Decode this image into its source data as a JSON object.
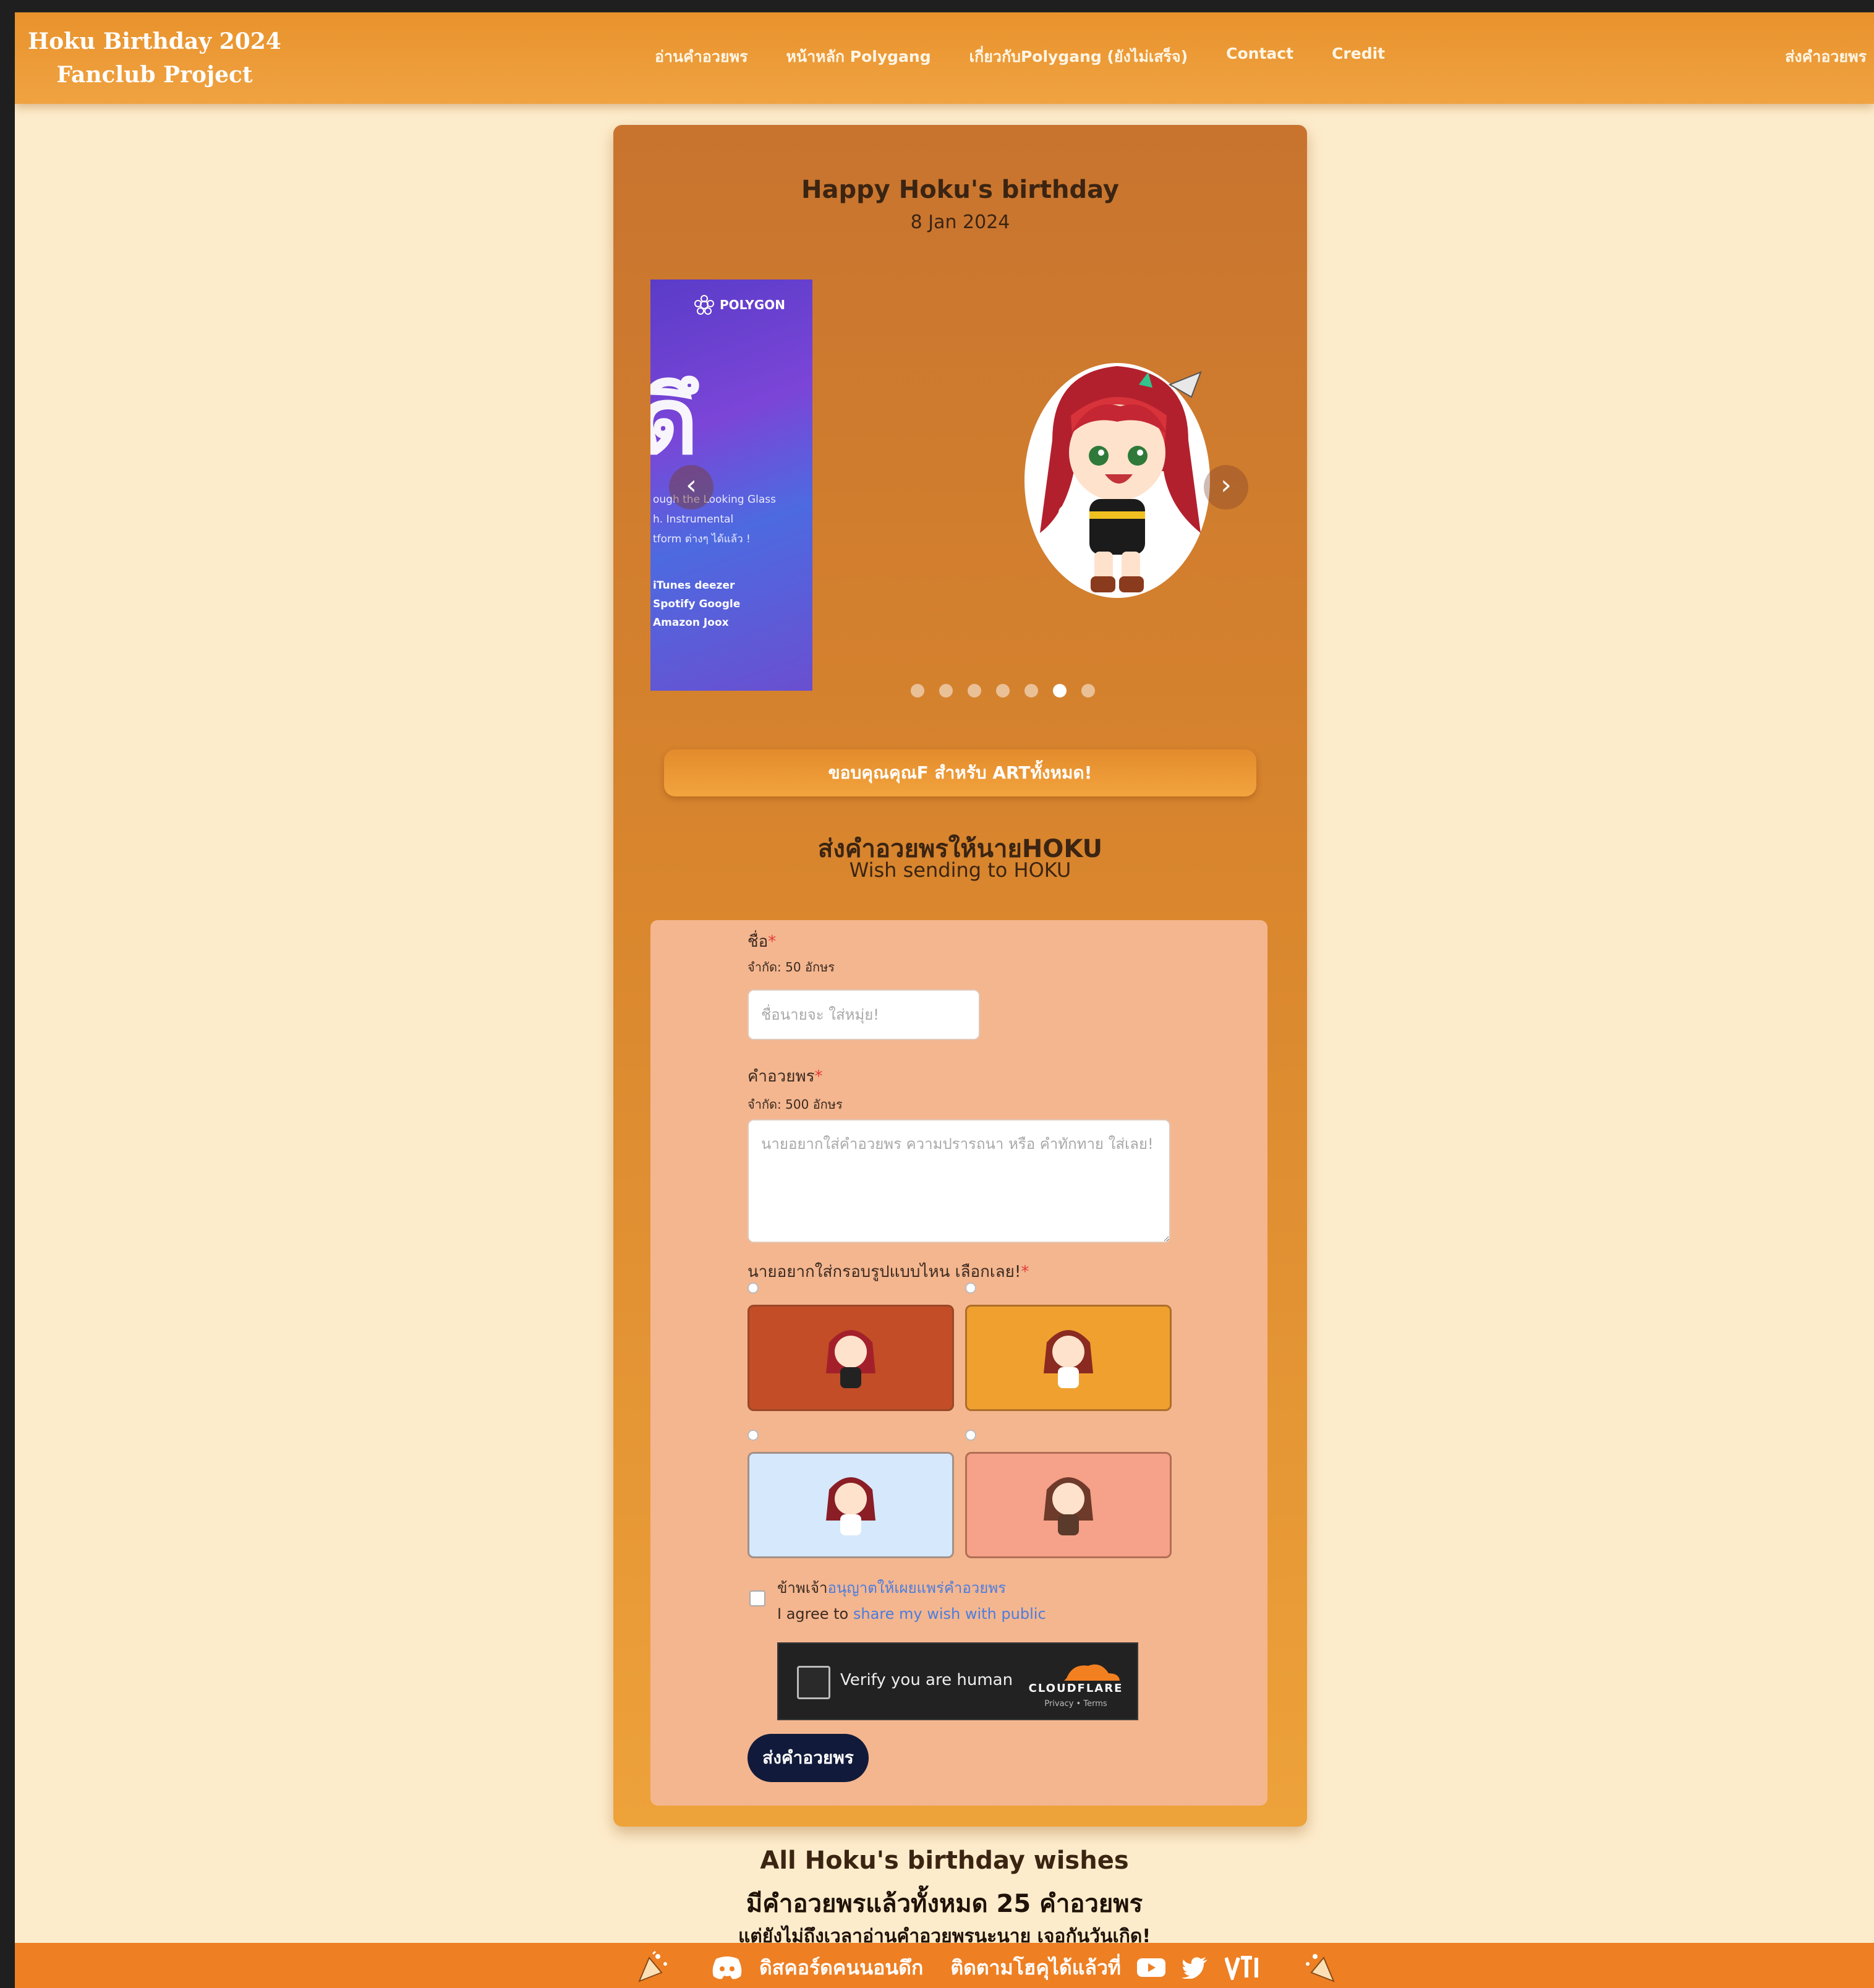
{
  "navbar": {
    "brand_line1": "Hoku Birthday 2024",
    "brand_line2": "Fanclub Project",
    "links": [
      "อ่านคำอวยพร",
      "หน้าหลัก Polygang",
      "เกี่ยวกับPolygang (ยังไม่เสร็จ)",
      "Contact",
      "Credit"
    ],
    "right_link": "ส่งคำอวยพร"
  },
  "card": {
    "title": "Happy Hoku's birthday",
    "date": "8 Jan 2024",
    "carousel": {
      "poly_logo": "POLYGON",
      "poly_big": "ดึ",
      "poly_text": [
        "ough the Looking Glass",
        "h. Instrumental",
        "tform ต่างๆ ได้แล้ว !"
      ],
      "poly_stores": [
        "iTunes   deezer",
        "Spotify  Google",
        "Amazon  Joox"
      ],
      "slide_count": 7,
      "active_index": 5
    },
    "thanks_bar": "ขอบคุณคุณF สำหรับ ARTทั้งหมด!",
    "wish_heading_th": "ส่งคำอวยพรให้นายHOKU",
    "wish_heading_en": "Wish sending to HOKU"
  },
  "form": {
    "name_label": "ชื่อ",
    "name_limit": "จำกัด: 50 อักษร",
    "name_placeholder": "ชื่อนายจะ ใส่หมุ่ย!",
    "wish_label": "คำอวยพร",
    "wish_limit": "จำกัด: 500 อักษร",
    "wish_placeholder": "นายอยากใส่คำอวยพร ความปรารถนา หรือ คำทักทาย ใส่เลย!",
    "frame_label": "นายอยากใส่กรอบรูปแบบไหน เลือกเลย!",
    "frames": [
      {
        "color": "#c24d26"
      },
      {
        "color": "#efa02e"
      },
      {
        "color": "#d6e8fb"
      },
      {
        "color": "#f6a189"
      }
    ],
    "agree_th_prefix": "ข้าพเจ้า",
    "agree_th_link": "อนุญาตให้เผยแพร่คำอวยพร",
    "agree_en_prefix": "I agree to ",
    "agree_en_link": "share my wish with public",
    "captcha_text": "Verify you are human",
    "captcha_brand": "CLOUDFLARE",
    "captcha_links": "Privacy  •  Terms",
    "submit_label": "ส่งคำอวยพร"
  },
  "summary": {
    "all_wishes": "All Hoku's birthday wishes",
    "count_line": "มีคำอวยพรแล้วทั้งหมด 25 คำอวยพร",
    "see_line": "แต่ยังไม่ถึงเวลาอ่านคำอวยพรนะนาย เจอกันวันเกิด!"
  },
  "footer": {
    "discord_text": "ดิสคอร์ดคนนอนดึก",
    "follow_text": "ติดตามโฮคุได้แล้วที่"
  },
  "colors": {
    "nav": "#e8922c",
    "page_bg": "#fdeccb",
    "card": "#d9862e",
    "form_bg": "#f4b68f",
    "footer": "#ee7f23",
    "submit": "#111a3a"
  }
}
